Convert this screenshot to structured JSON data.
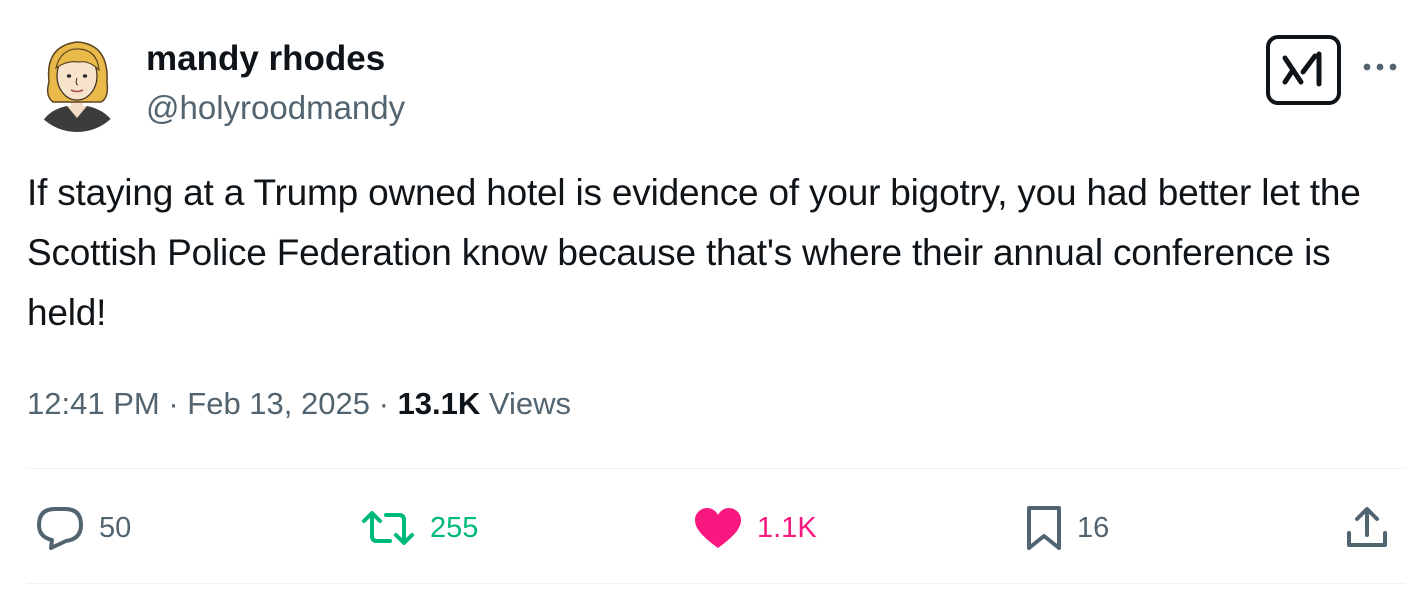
{
  "author": {
    "display_name": "mandy rhodes",
    "handle": "@holyroodmandy",
    "avatar_icon": "cartoon-portrait-avatar"
  },
  "header_actions": {
    "grok_icon": "grok-icon",
    "more_icon": "more-horizontal-icon"
  },
  "tweet": {
    "text": "If staying at a Trump owned hotel is evidence of your bigotry, you had better let the Scottish Police Federation know because that's where their annual conference is held!"
  },
  "meta": {
    "time": "12:41 PM",
    "separator": "·",
    "date": "Feb 13, 2025",
    "views_count": "13.1K",
    "views_label": "Views"
  },
  "actions": {
    "reply": {
      "icon": "reply-bubble-icon",
      "count": "50"
    },
    "repost": {
      "icon": "repost-icon",
      "count": "255"
    },
    "like": {
      "icon": "heart-filled-icon",
      "count": "1.1K"
    },
    "bookmark": {
      "icon": "bookmark-icon",
      "count": "16"
    },
    "share": {
      "icon": "share-upload-icon"
    }
  },
  "colors": {
    "text_primary": "#0f1419",
    "text_secondary": "#536471",
    "repost_green": "#00ba7c",
    "like_pink": "#f91880",
    "divider": "#eff3f4"
  }
}
